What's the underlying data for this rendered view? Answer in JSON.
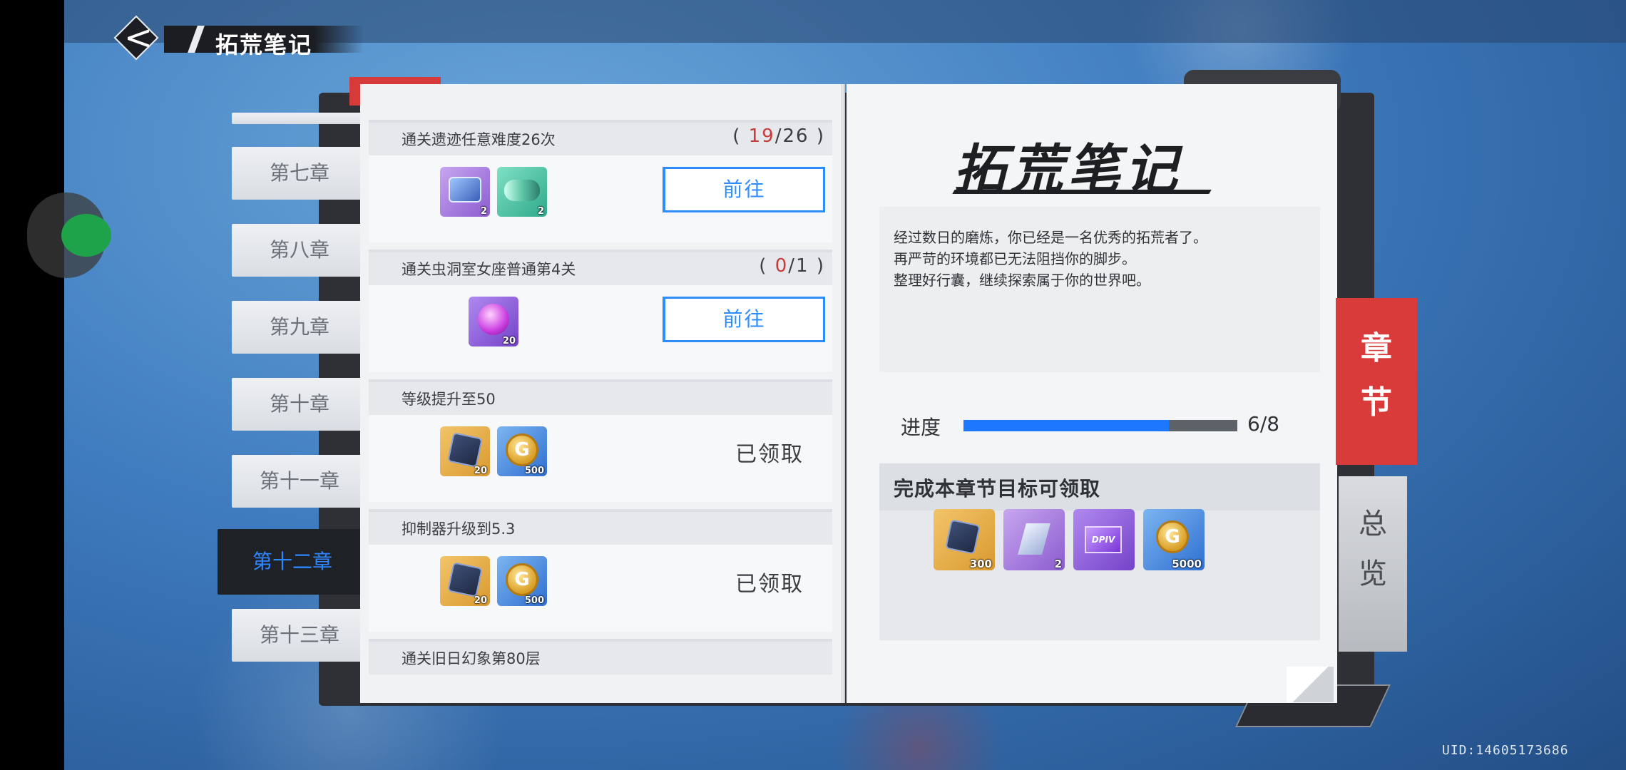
{
  "header": {
    "title": "拓荒笔记"
  },
  "chapters": [
    {
      "label": "第七章",
      "active": false
    },
    {
      "label": "第八章",
      "active": false
    },
    {
      "label": "第九章",
      "active": false
    },
    {
      "label": "第十章",
      "active": false
    },
    {
      "label": "第十一章",
      "active": false
    },
    {
      "label": "第十二章",
      "active": true
    },
    {
      "label": "第十三章",
      "active": false
    }
  ],
  "tasks": [
    {
      "title": "通关遗迹任意难度26次",
      "progress_current": "19",
      "progress_total": "26",
      "rewards": [
        {
          "icon": "blue-crate-icon",
          "count": "2"
        },
        {
          "icon": "teal-capsule-icon",
          "count": "2"
        }
      ],
      "action": "前往"
    },
    {
      "title": "通关虫洞室女座普通第4关",
      "progress_current": "0",
      "progress_total": "1",
      "rewards": [
        {
          "icon": "purple-orb-icon",
          "count": "20"
        }
      ],
      "action": "前往"
    },
    {
      "title": "等级提升至50",
      "rewards": [
        {
          "icon": "dark-cube-icon",
          "count": "20"
        },
        {
          "icon": "gold-coin-icon",
          "count": "500"
        }
      ],
      "status": "已领取"
    },
    {
      "title": "抑制器升级到5.3",
      "rewards": [
        {
          "icon": "dark-cube-icon",
          "count": "20"
        },
        {
          "icon": "gold-coin-icon",
          "count": "500"
        }
      ],
      "status": "已领取"
    },
    {
      "title": "通关旧日幻象第80层"
    }
  ],
  "right_page": {
    "title": "拓荒笔记",
    "description": [
      "经过数日的磨炼，你已经是一名优秀的拓荒者了。",
      "再严苛的环境都已无法阻挡你的脚步。",
      "整理好行囊，继续探索属于你的世界吧。"
    ],
    "progress_label": "进度",
    "progress_text": "6/8",
    "progress_fraction": 0.75,
    "claim_title": "完成本章节目标可领取",
    "claim_rewards": [
      {
        "icon": "dark-cube-icon",
        "count": "300"
      },
      {
        "icon": "crystal-shard-icon",
        "count": "2"
      },
      {
        "icon": "dpiv-card-icon",
        "count": "",
        "label": "DPIV"
      },
      {
        "icon": "gold-coin-icon",
        "count": "5000"
      }
    ]
  },
  "side_tabs": {
    "chapter": [
      "章",
      "节"
    ],
    "overview": [
      "总",
      "览"
    ]
  },
  "uid": "UID:14605173686",
  "colors": {
    "accent_blue": "#2f8cff",
    "accent_red": "#d93a3a",
    "progress_red": "#c73b3b"
  }
}
